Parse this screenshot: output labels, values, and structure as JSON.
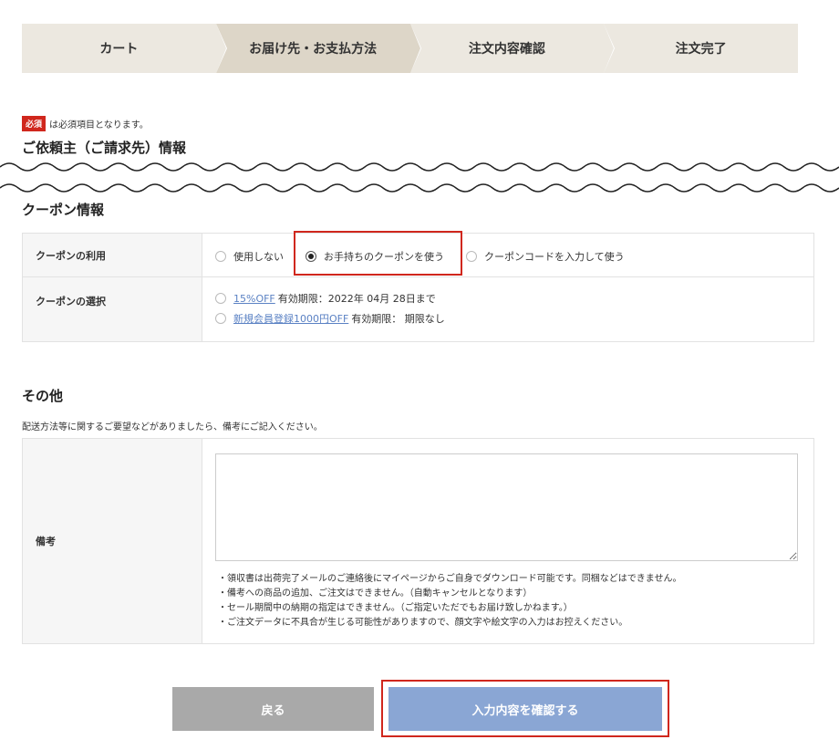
{
  "steps": [
    {
      "label": "カート"
    },
    {
      "label": "お届け先・お支払方法"
    },
    {
      "label": "注文内容確認"
    },
    {
      "label": "注文完了"
    }
  ],
  "required_note": {
    "badge": "必須",
    "text": "は必須項目となります。"
  },
  "client_info_title": "ご依頼主（ご請求先）情報",
  "coupon": {
    "title": "クーポン情報",
    "usage_label": "クーポンの利用",
    "options": [
      "使用しない",
      "お手持ちのクーポンを使う",
      "クーポンコードを入力して使う"
    ],
    "selected_option": "お手持ちのクーポンを使う",
    "select_label": "クーポンの選択",
    "coupons": [
      {
        "name": "15%OFF",
        "expiry": "有効期限：2022年 04月 28日まで"
      },
      {
        "name": "新規会員登録1000円OFF",
        "expiry": "有効期限： 期限なし"
      }
    ]
  },
  "other": {
    "title": "その他",
    "intro": "配送方法等に関するご要望などがありましたら、備考にご記入ください。",
    "remarks_label": "備考",
    "remarks_value": "",
    "notes": [
      "・領収書は出荷完了メールのご連絡後にマイページからご自身でダウンロード可能です。同梱などはできません。",
      "・備考への商品の追加、ご注文はできません。（自動キャンセルとなります）",
      "・セール期間中の納期の指定はできません。（ご指定いただでもお届け致しかねます。）",
      "・ご注文データに不具合が生じる可能性がありますので、顔文字や絵文字の入力はお控えください。"
    ]
  },
  "buttons": {
    "back": "戻る",
    "confirm": "入力内容を確認する"
  },
  "colors": {
    "accent_red": "#d0271d",
    "confirm_blue": "#8aa6d4",
    "back_gray": "#a9a9a9",
    "link_blue": "#5b82c4"
  }
}
